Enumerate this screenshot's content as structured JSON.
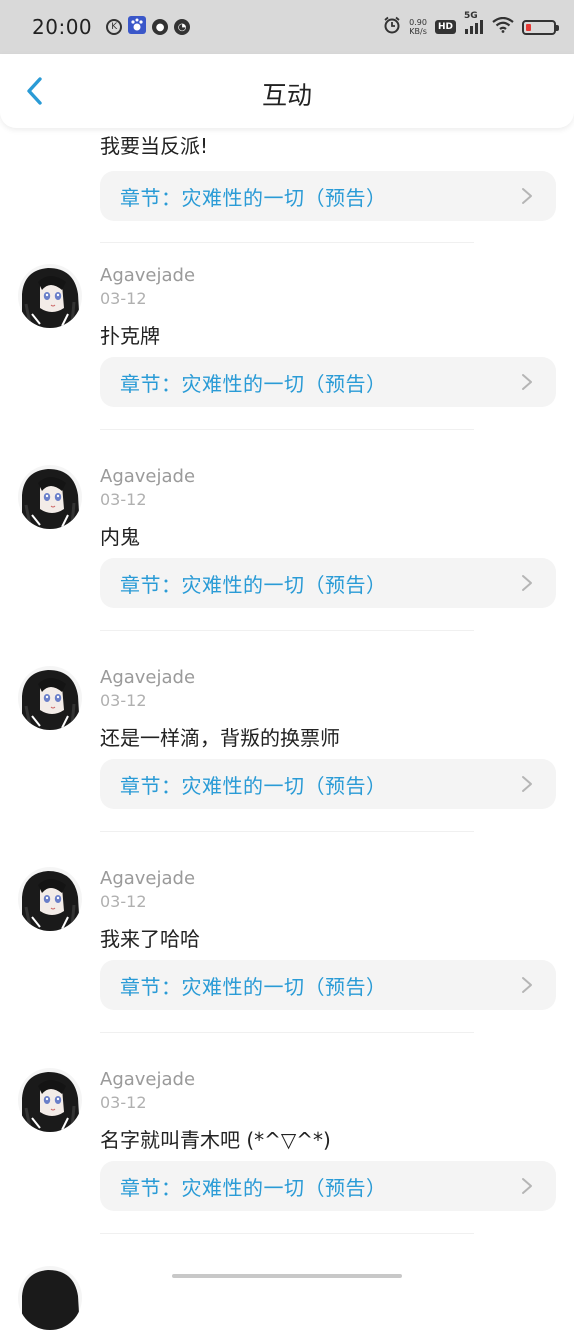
{
  "status_bar": {
    "time": "20:00",
    "speed_value": "0.90",
    "speed_unit": "KB/s",
    "hd": "HD",
    "network": "5G",
    "battery_level": 0.18
  },
  "header": {
    "title": "互动"
  },
  "first_item": {
    "comment": "我要当反派!",
    "chapter": "章节：灾难性的一切（预告）"
  },
  "items": [
    {
      "username": "Agavejade",
      "date": "03-12",
      "comment": "扑克牌",
      "chapter": "章节：灾难性的一切（预告）"
    },
    {
      "username": "Agavejade",
      "date": "03-12",
      "comment": "内鬼",
      "chapter": "章节：灾难性的一切（预告）"
    },
    {
      "username": "Agavejade",
      "date": "03-12",
      "comment": "还是一样滴，背叛的换票师",
      "chapter": "章节：灾难性的一切（预告）"
    },
    {
      "username": "Agavejade",
      "date": "03-12",
      "comment": "我来了哈哈",
      "chapter": "章节：灾难性的一切（预告）"
    },
    {
      "username": "Agavejade",
      "date": "03-12",
      "comment": "名字就叫青木吧 (*^▽^*)",
      "chapter": "章节：灾难性的一切（预告）"
    }
  ],
  "colors": {
    "accent": "#2a9bd6",
    "status_bar_bg": "#d9d9d9",
    "chapter_bg": "#f4f4f4"
  }
}
